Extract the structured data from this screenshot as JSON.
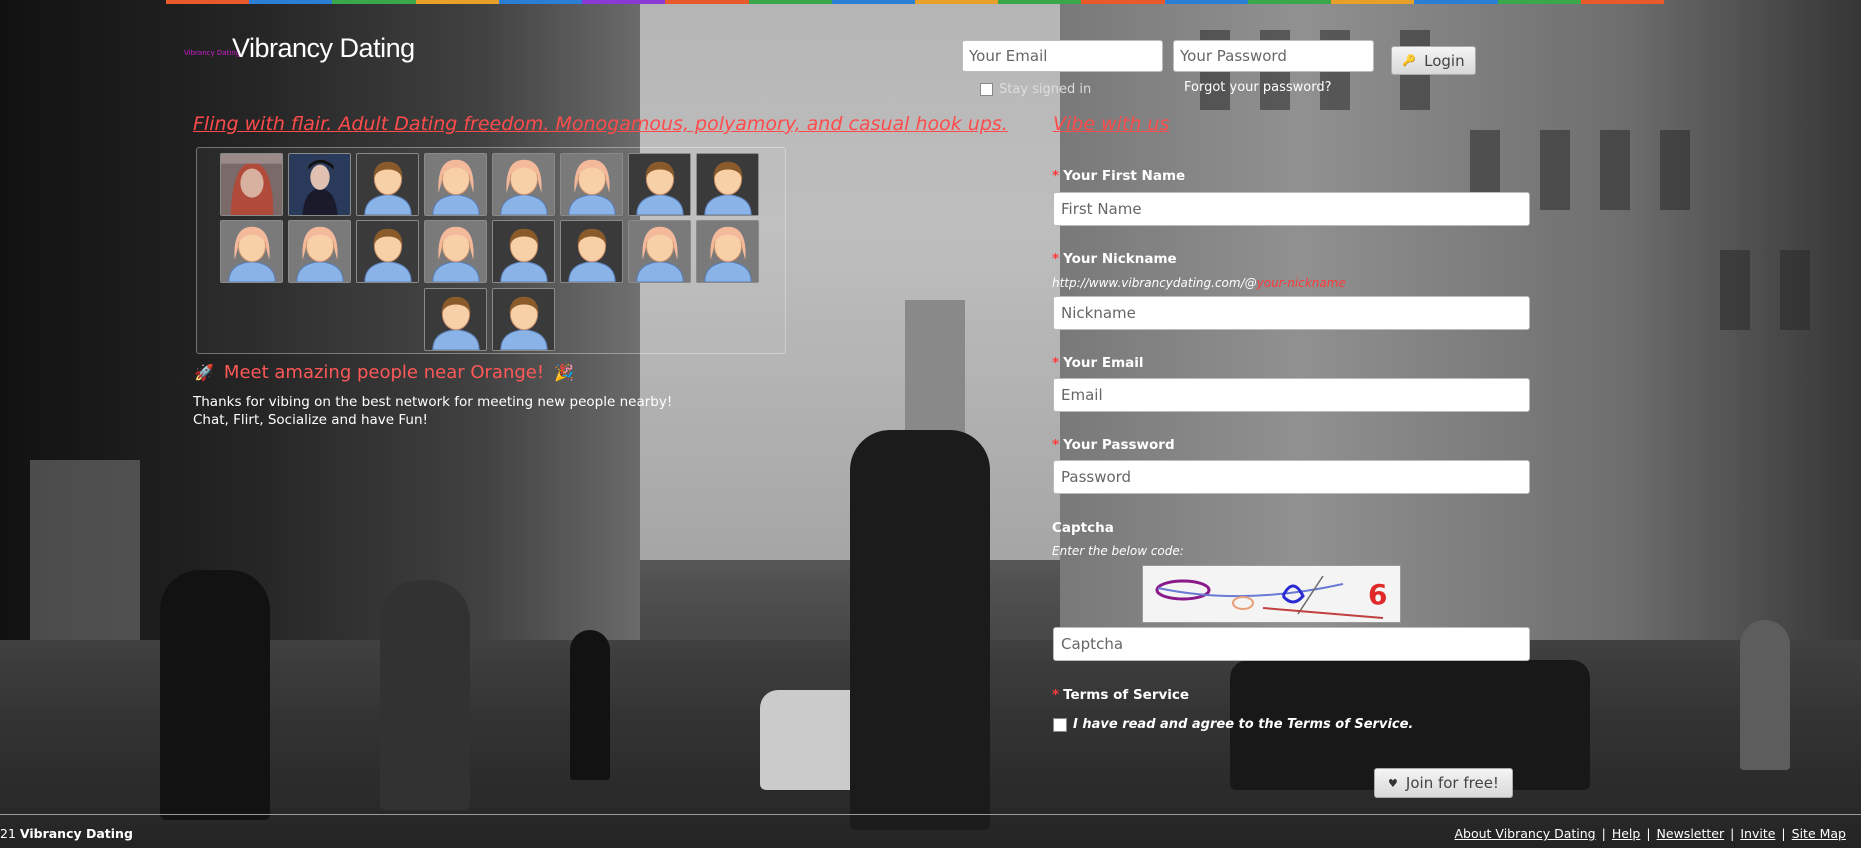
{
  "header": {
    "logo_small": "Vibrancy Dating",
    "brand": "Vibrancy Dating",
    "top_colors": [
      "#e85a2a",
      "#2a7fd4",
      "#3aa84a",
      "#e8a02a",
      "#2a7fd4",
      "#8a3ad4",
      "#e85a2a",
      "#3aa84a",
      "#2a7fd4",
      "#e8a02a",
      "#3aa84a",
      "#e85a2a",
      "#2a7fd4",
      "#3aa84a",
      "#e8a02a",
      "#2a7fd4",
      "#3aa84a",
      "#e85a2a"
    ]
  },
  "login": {
    "email_placeholder": "Your Email",
    "password_placeholder": "Your Password",
    "login_label": "Login",
    "login_icon": "key-icon",
    "stay_signed_in": "Stay signed in",
    "forgot": "Forgot your password?"
  },
  "left": {
    "tagline": "Fling with flair. Adult Dating freedom. Monogamous, polyamory, and casual hook ups.",
    "members": [
      {
        "type": "photo-female"
      },
      {
        "type": "photo-male"
      },
      {
        "type": "male"
      },
      {
        "type": "female"
      },
      {
        "type": "female"
      },
      {
        "type": "female"
      },
      {
        "type": "male"
      },
      {
        "type": "male"
      },
      {
        "type": "female"
      },
      {
        "type": "female"
      },
      {
        "type": "male"
      },
      {
        "type": "female"
      },
      {
        "type": "male"
      },
      {
        "type": "male"
      },
      {
        "type": "female"
      },
      {
        "type": "female"
      },
      {
        "type": "male"
      },
      {
        "type": "male"
      }
    ],
    "meet_icon_left": "🚀",
    "meet_text": "Meet amazing people near Orange!",
    "meet_icon_right": "🎉",
    "thanks": "Thanks for vibing on the best network for meeting new people nearby! Chat, Flirt, Socialize and have Fun!"
  },
  "signup": {
    "heading": "Vibe with us",
    "first_name_label": "Your First Name",
    "first_name_placeholder": "First Name",
    "nickname_label": "Your Nickname",
    "nickname_url": "http://www.vibrancydating.com/@",
    "nickname_url_suffix": "your-nickname",
    "nickname_placeholder": "Nickname",
    "email_label": "Your Email",
    "email_placeholder": "Email",
    "password_label": "Your Password",
    "password_placeholder": "Password",
    "captcha_label": "Captcha",
    "captcha_hint": "Enter the below code:",
    "captcha_placeholder": "Captcha",
    "tos_label": "Terms of Service",
    "tos_text": "I have read and agree to the Terms of Service.",
    "join_label": "Join for free!",
    "join_icon": "heart-icon"
  },
  "footer": {
    "copyright_prefix": "21",
    "copyright_brand": "Vibrancy Dating",
    "links": [
      "About Vibrancy Dating",
      "Help",
      "Newsletter",
      "Invite",
      "Site Map"
    ]
  },
  "colors": {
    "accent_red": "#ff4b4b",
    "avatar_male_hair": "#8a5a2a",
    "avatar_female_hair": "#f4b89a",
    "avatar_shirt": "#8ab4e8"
  }
}
